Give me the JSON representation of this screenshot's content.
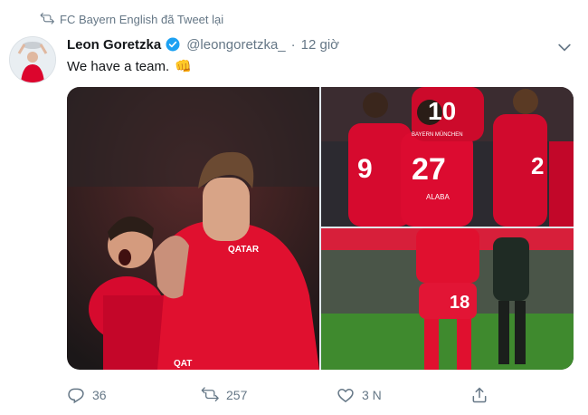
{
  "retweet": {
    "text": "FC Bayern English đã Tweet lại"
  },
  "author": {
    "name": "Leon Goretzka",
    "handle": "@leongoretzka_",
    "separator": "·",
    "time": "12 giờ"
  },
  "tweet": {
    "text": "We have a team.",
    "emoji": "👊"
  },
  "media": {
    "photo1": {
      "sponsor_text": "QATAR",
      "bottom_text": "QAT"
    },
    "photo2": {
      "shirt_numbers": [
        "10",
        "9",
        "27",
        "2"
      ],
      "name_labels": [
        "BAYERN MÜNCHEN",
        "ALABA"
      ]
    },
    "photo3": {
      "shirt_number": "18"
    }
  },
  "actions": {
    "reply_count": "36",
    "retweet_count": "257",
    "like_count": "3 N"
  },
  "colors": {
    "accent": "#1da1f2",
    "muted": "#657786",
    "bayern_red": "#dc052d"
  }
}
